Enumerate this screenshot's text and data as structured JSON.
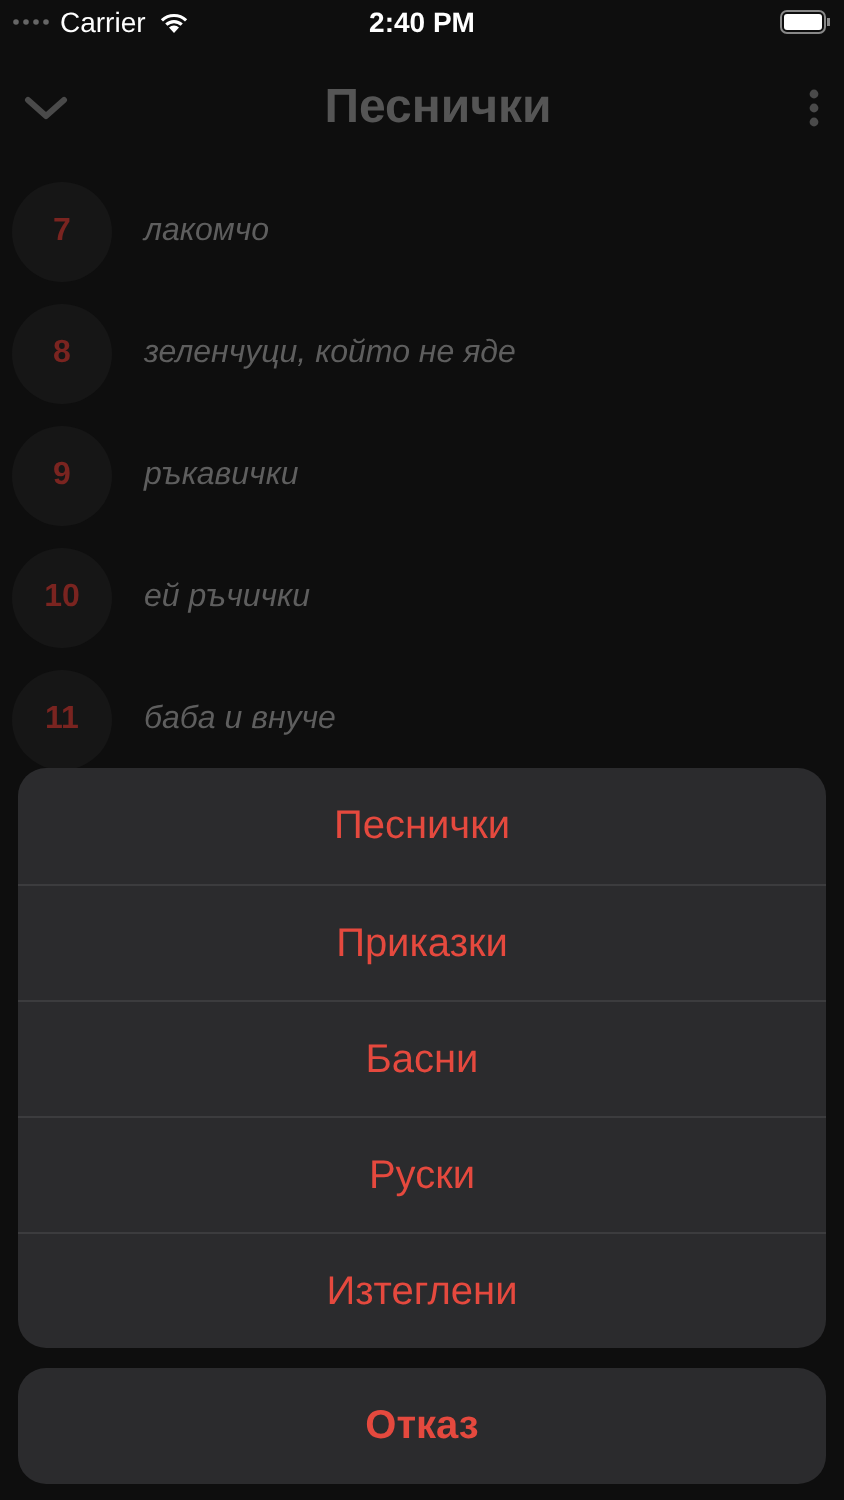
{
  "status_bar": {
    "carrier": "Carrier",
    "time": "2:40 PM"
  },
  "nav": {
    "title": "Песнички"
  },
  "rows": [
    {
      "number": "7",
      "title": "лакомчо"
    },
    {
      "number": "8",
      "title": "зеленчуци, който не яде"
    },
    {
      "number": "9",
      "title": "ръкавички"
    },
    {
      "number": "10",
      "title": "ей ръчички"
    },
    {
      "number": "11",
      "title": "баба и внуче"
    }
  ],
  "action_sheet": {
    "options": [
      "Песнички",
      "Приказки",
      "Басни",
      "Руски",
      "Изтеглени"
    ],
    "cancel": "Отказ"
  }
}
